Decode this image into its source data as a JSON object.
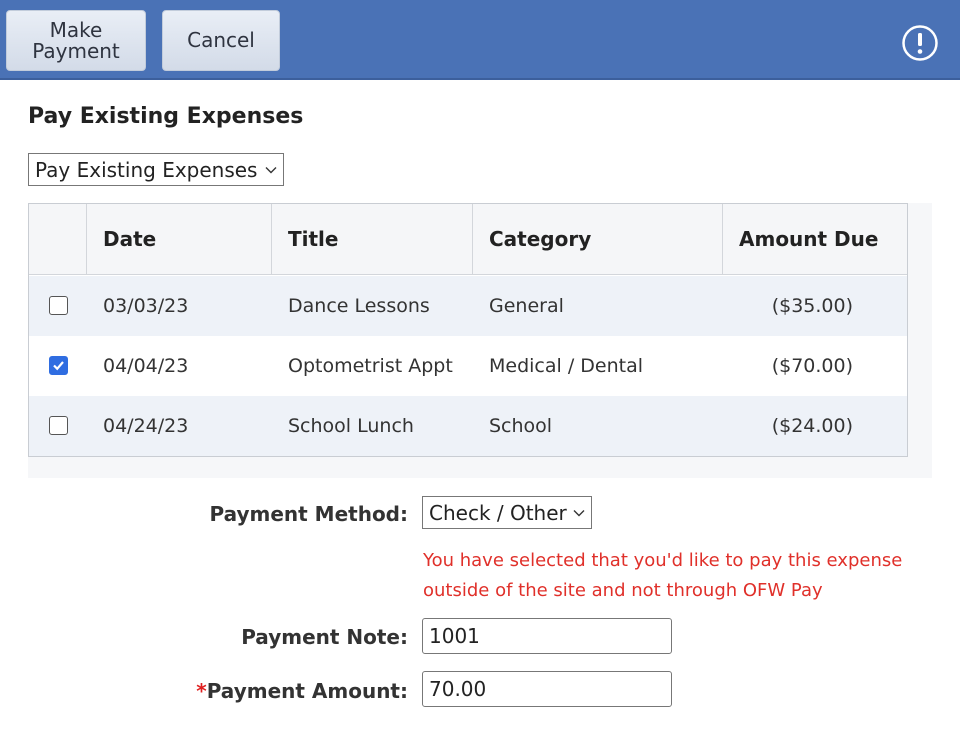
{
  "toolbar": {
    "make_payment_line1": "Make",
    "make_payment_line2": "Payment",
    "cancel_label": "Cancel"
  },
  "page": {
    "title": "Pay Existing Expenses",
    "filter_selected": "Pay Existing Expenses"
  },
  "table": {
    "headers": {
      "date": "Date",
      "title": "Title",
      "category": "Category",
      "amount_due": "Amount Due"
    },
    "rows": [
      {
        "checked": false,
        "date": "03/03/23",
        "title": "Dance Lessons",
        "category": "General",
        "amount": "($35.00)"
      },
      {
        "checked": true,
        "date": "04/04/23",
        "title": "Optometrist Appt",
        "category": "Medical / Dental",
        "amount": "($70.00)"
      },
      {
        "checked": false,
        "date": "04/24/23",
        "title": "School Lunch",
        "category": "School",
        "amount": "($24.00)"
      }
    ]
  },
  "form": {
    "payment_method_label": "Payment Method:",
    "payment_method_value": "Check / Other",
    "notice_line1": "You have selected that you'd like to pay this expense",
    "notice_line2": "outside of the site and not through OFW Pay",
    "payment_note_label": "Payment Note:",
    "payment_note_value": "1001",
    "required_mark": "*",
    "payment_amount_label": "Payment Amount:",
    "payment_amount_value": "70.00"
  },
  "colors": {
    "toolbar": "#4a72b6",
    "checkbox_checked": "#2f6de1",
    "notice": "#e0302a",
    "row_alt": "#eef2f8"
  },
  "icons": {
    "alert": "exclamation-circle-icon",
    "dropdown": "chevron-down-icon",
    "check": "checkmark-icon"
  }
}
